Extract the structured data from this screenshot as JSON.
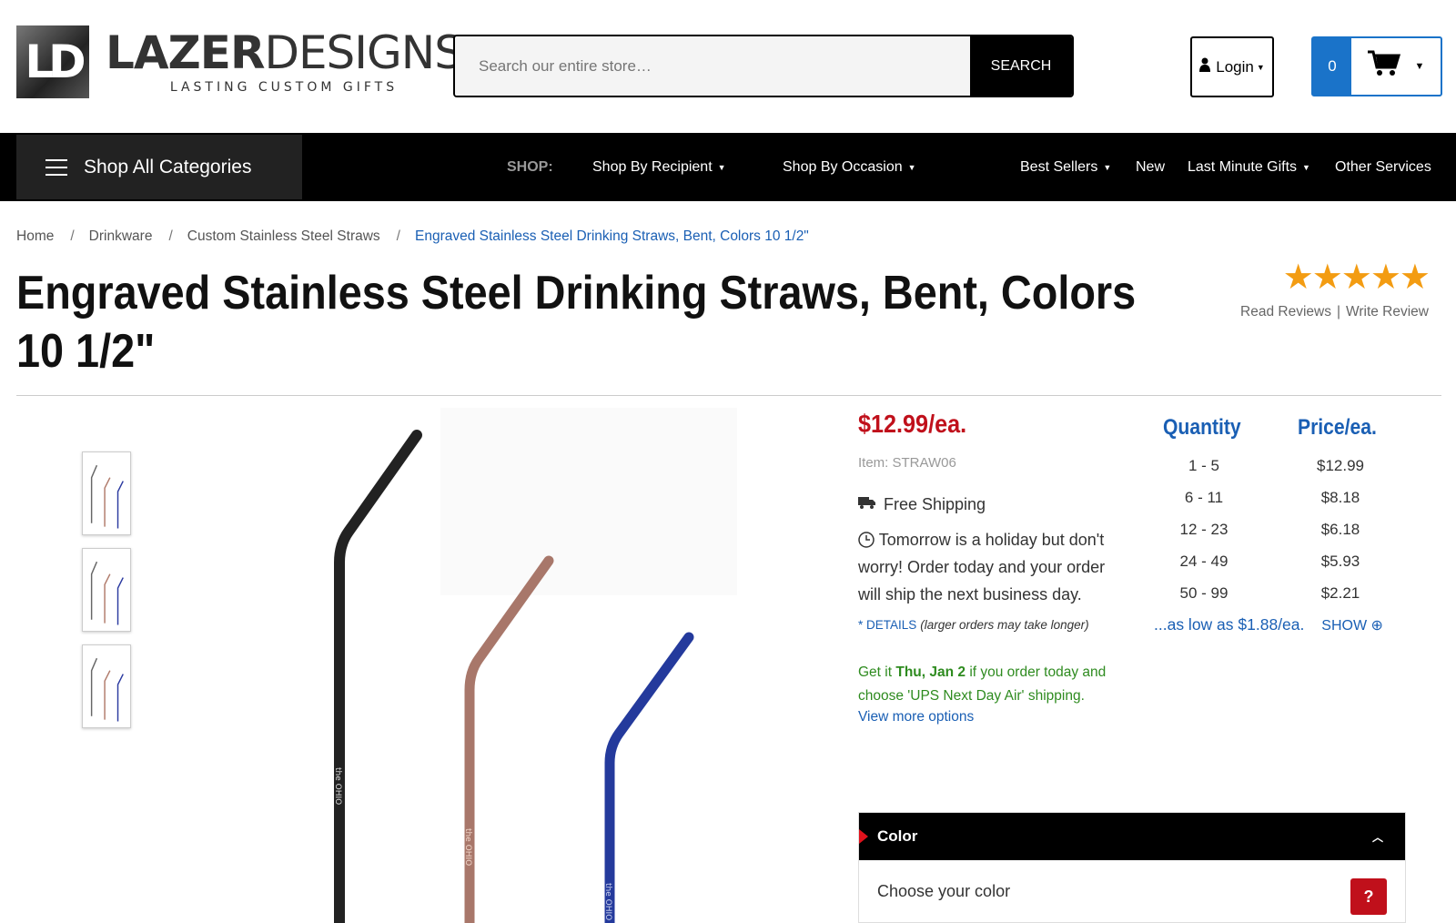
{
  "header": {
    "logo_initials": "LD",
    "logo_name_bold": "LAZER",
    "logo_name_light": "DESIGNS",
    "logo_tagline": "LASTING CUSTOM GIFTS",
    "search_placeholder": "Search our entire store…",
    "search_button": "SEARCH",
    "login_label": "Login",
    "cart_count": "0"
  },
  "nav": {
    "shop_all": "Shop All Categories",
    "shop_label": "SHOP:",
    "items": [
      "Shop By Recipient",
      "Shop By Occasion",
      "Best Sellers",
      "New",
      "Last Minute Gifts",
      "Other Services"
    ]
  },
  "breadcrumb": [
    "Home",
    "Drinkware",
    "Custom Stainless Steel Straws",
    "Engraved Stainless Steel Drinking Straws, Bent, Colors 10 1/2\""
  ],
  "product": {
    "title": "Engraved Stainless Steel Drinking Straws, Bent, Colors 10 1/2\"",
    "rating_stars": 5,
    "read_reviews": "Read Reviews",
    "write_review": "Write Review",
    "price": "$12.99/ea.",
    "item_no": "Item: STRAW06",
    "free_shipping": "Free Shipping",
    "holiday_note": "Tomorrow is a holiday but don't worry! Order today and your order will ship the next business day.",
    "details_link": "* DETAILS",
    "details_note": "(larger orders may take longer)",
    "getit_prefix": "Get it ",
    "getit_date": "Thu, Jan 2",
    "getit_suffix": " if you order today and choose 'UPS Next Day Air' shipping.",
    "view_more": "View more options",
    "image_engraving": "the OHIO"
  },
  "pricing": {
    "qty_header": "Quantity",
    "price_header": "Price/ea.",
    "rows": [
      {
        "qty": "1 - 5",
        "price": "$12.99"
      },
      {
        "qty": "6 - 11",
        "price": "$8.18"
      },
      {
        "qty": "12 - 23",
        "price": "$6.18"
      },
      {
        "qty": "24 - 49",
        "price": "$5.93"
      },
      {
        "qty": "50 - 99",
        "price": "$2.21"
      }
    ],
    "as_low_as": "...as low as $1.88/ea.",
    "show": "SHOW"
  },
  "options": {
    "color_title": "Color",
    "color_prompt": "Choose your color",
    "help": "?"
  },
  "colors": {
    "accent_blue": "#1a73c9",
    "price_red": "#c0101b",
    "star_orange": "#f39c12",
    "ship_green": "#2e8b1f"
  }
}
